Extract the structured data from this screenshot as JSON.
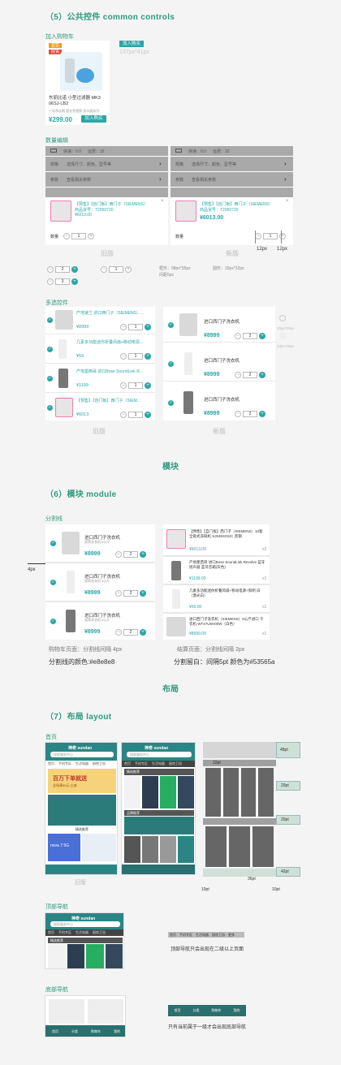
{
  "sections": {
    "common_controls": "（5）公共控件 common controls",
    "module_title": "模块",
    "module": "（6）模块 module",
    "layout_title": "布局",
    "layout": "（7）布局 layout"
  },
  "add_to_cart": {
    "heading": "加入购物车",
    "badge": "加入购买",
    "size_note": "137px*41px",
    "tag1": "直营",
    "tag2": "好货",
    "product_name": "东丽比诺 小型过滤器 MK3 06SJ-LB2",
    "product_sub": "一年净化期 超长免更换 净水器系列",
    "price": "¥299.00",
    "button": "加入购买"
  },
  "qty_edit": {
    "heading": "数量编辑",
    "ship_label": "快递：0.0",
    "ship_fee": "运费：32",
    "spec_label": "规格",
    "spec_value": "选择尺寸、颜色、型号等",
    "param_label": "参数",
    "param_value": "查看相关参数",
    "item_title": "【预售】【自门板】西门子（SIEMENS）",
    "item_code": "商品货号：T2950720",
    "item_price": "¥6013.00",
    "qty_label": "数量",
    "qty_value": "1",
    "old_caption": "旧版",
    "new_caption": "新版",
    "dim1": "12px",
    "dim2": "12px",
    "stepper_a": "2",
    "stepper_b": "1",
    "stepper_c": "3",
    "note1": "框形：98px*35px",
    "note2": "圆形：32px*32px",
    "note3": "间距5px"
  },
  "multi_select": {
    "heading": "多选控件",
    "old_items": [
      {
        "title": "产地速兰 进口西门子（SIEMENS）...",
        "price": "¥8999",
        "qty": "1"
      },
      {
        "title": "几素多功能迷你折叠风扇+移动电源...",
        "price": "¥59",
        "qty": "1"
      },
      {
        "title": "产地墨西哥 进口Bose SoundLink R...",
        "price": "¥1199",
        "qty": "1"
      },
      {
        "title": "【预售】【自门板】西门子（SIEM...",
        "price": "¥6013",
        "qty": "1"
      }
    ],
    "new_items": [
      {
        "title": "进口西门子洗衣机",
        "price": "¥8999",
        "qty": "2"
      },
      {
        "title": "进口西门子洗衣机",
        "price": "¥8999",
        "qty": "2"
      },
      {
        "title": "进口西门子洗衣机",
        "price": "¥8999",
        "qty": "2"
      }
    ],
    "side_note1": "20px*20px",
    "side_note2": "20px*20px",
    "old_caption": "旧版",
    "new_caption": "新版"
  },
  "divider": {
    "heading": "分割线",
    "left_items": [
      {
        "title": "进口西门子洗衣机",
        "sub": "滚筒洗衣机 8公斤",
        "price": "¥8999",
        "qty": "2"
      },
      {
        "title": "进口西门子洗衣机",
        "sub": "滚筒洗衣机 8公斤",
        "price": "¥8999",
        "qty": "2"
      },
      {
        "title": "进口西门子洗衣机",
        "sub": "滚筒洗衣机 8公斤",
        "price": "¥8999",
        "qty": "2"
      }
    ],
    "right_items": [
      {
        "title": "【预售】【自门板】西门子（SIEMENS）10套全嵌式洗碗机 SJ636X03JC 黑钢",
        "price": "¥6013.00",
        "qty": "x2"
      },
      {
        "title": "产地墨西哥 进口Bose SoundLink Revolve 蓝牙扬声器 蓝牙音箱(灰色)",
        "price": "¥1199.00",
        "qty": "x1"
      },
      {
        "title": "几素多功能迷你折叠风扇+移动电源+照明 白（激光白）",
        "price": "¥59.00",
        "qty": "x1"
      },
      {
        "title": "进口西门子洗衣机（SIEMENS）9公斤进口 干衣机 WT47U6H00W（白色）",
        "price": "¥8999.00",
        "qty": "x1"
      }
    ],
    "px_note": "4px",
    "left_caption": "购物车页面：分割线间隔 4px",
    "right_caption": "结算页面：分割线间隔 2px",
    "left_color": "分割线的颜色:#e8e8e8",
    "right_color": "分割留白：间隔5pt 颜色为#53565a"
  },
  "layout": {
    "home_label": "首页",
    "old_caption": "旧版",
    "brand": "神奇 sundan",
    "search": "搜索服务中心",
    "tabs": [
      "首页",
      "手机专区",
      "生活电器",
      "厨房卫浴",
      "更多"
    ],
    "banner": "百万下单就送",
    "banner_sub": "全场满50元 立减",
    "section_label": "精选推荐",
    "category_label": "品牌推荐",
    "nova_label": "nova 7 5G",
    "dim_48": "48pt",
    "dim_22": "22pt",
    "dim_20a": "20pt",
    "dim_20b": "20pt",
    "dim_42": "42pt",
    "dim_36": "36pt",
    "dim_10a": "10pt",
    "dim_10b": "10pt",
    "top_nav_label": "顶部导航",
    "top_nav_note": "顶部导航只会出现在二级以上页面",
    "bottom_nav_label": "底部导航",
    "bottom_nav_note": "只有当前属于一级才会出现底部导航",
    "bottom_tabs": [
      "首页",
      "分类",
      "购物车",
      "我的"
    ]
  },
  "colors": {
    "accent": "#2aa6a6",
    "heading": "#2f9a7e",
    "divider": "#e8e8e8",
    "gap": "#53565a"
  }
}
